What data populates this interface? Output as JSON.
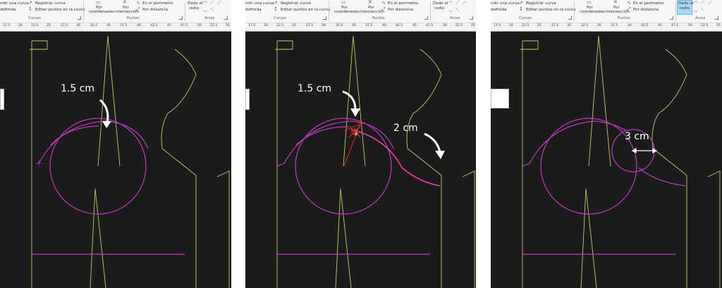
{
  "ribbon": {
    "curvas_items": [
      "ndir una curva",
      "Registrar curva",
      "definida",
      "Editar puntos en la curva"
    ],
    "curvas_group": "Curvas",
    "puntos_items": [
      "Por coordenadas",
      "Por intersección",
      "En el perímetro",
      "Por distancia"
    ],
    "puntos_coord_lines": [
      "Por",
      "coordenadas"
    ],
    "puntos_inter_lines": [
      "Por",
      "intersección"
    ],
    "puntos_group": "Puntos",
    "arcos_button_lines": [
      "Dado el",
      "radio"
    ],
    "arcos_group": "Arcos",
    "icons": [
      "curve-register-icon",
      "curve-edit-icon",
      "point-coordinates-icon",
      "point-intersection-icon",
      "point-perimeter-icon",
      "point-distance-icon",
      "arc-radius-icon",
      "arc-tools-icon"
    ]
  },
  "ruler": {
    "panel1_ticks": [
      "17.5",
      "20",
      "22.5",
      "25",
      "27.5",
      "30",
      "32.5",
      "35",
      "37.5",
      "40",
      "42.5",
      "45",
      "47.5",
      "50",
      "52.5",
      "55"
    ],
    "panel2_ticks": [
      "17.5",
      "20",
      "22.5",
      "25",
      "27.5",
      "30",
      "32.5",
      "35",
      "37.5",
      "40",
      "42.5",
      "45",
      "47.5",
      "50",
      "52.5",
      "55"
    ],
    "panel3_ticks": [
      "17.5",
      "20",
      "22.5",
      "25",
      "27.5",
      "30",
      "32.5",
      "35",
      "37.5",
      "40",
      "42.5",
      "45",
      "47.5",
      "50",
      "52.5",
      "55"
    ]
  },
  "annotations": {
    "panel1": "1.5 cm",
    "panel2_a": "1.5 cm",
    "panel2_b": "2 cm",
    "panel3": "3 cm"
  },
  "colors": {
    "canvas": "#1b1b1b",
    "pattern_line": "#c8c86a",
    "curve": "#c238c2",
    "curve_bright": "#ff3aa8",
    "construction": "#e0301e",
    "annotation": "#ffffff",
    "selected_tool": "#a8d8f4"
  }
}
